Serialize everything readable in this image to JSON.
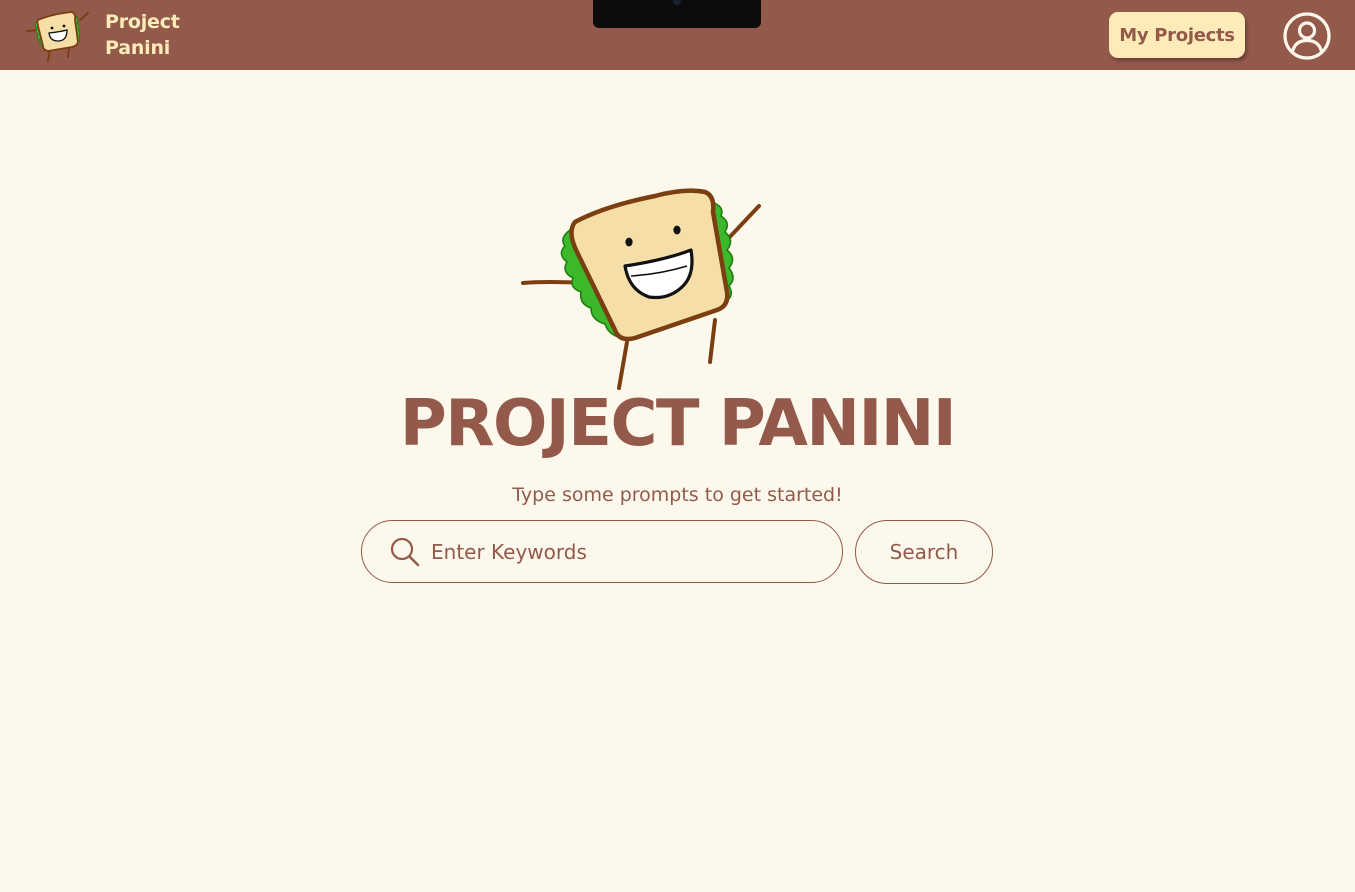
{
  "header": {
    "brand_line1": "Project",
    "brand_line2": "Panini",
    "my_projects_label": "My Projects",
    "account_icon": "account-circle-icon",
    "logo_icon": "sandwich-mascot-icon"
  },
  "hero": {
    "title": "PROJECT PANINI",
    "subtitle": "Type some prompts to get started!",
    "mascot_icon": "sandwich-mascot-icon"
  },
  "search": {
    "placeholder": "Enter Keywords",
    "value": "",
    "button_label": "Search",
    "icon": "search-icon"
  },
  "colors": {
    "brown": "#935A4B",
    "cream": "#FDF8EC",
    "butter": "#FDEBB9",
    "bread": "#F6DEA8",
    "lettuce": "#3DB82A"
  }
}
